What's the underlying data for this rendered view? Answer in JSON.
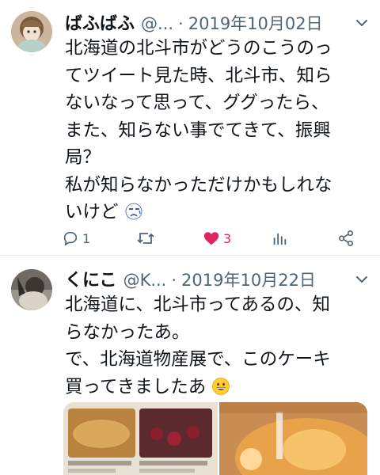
{
  "tweets": [
    {
      "display_name": "ばふばふ",
      "handle": "@...",
      "separator": "·",
      "date": "2019年10月02日",
      "text_lines": [
        "北海道の北斗市がどうのこうのっ",
        "てツイート見た時、北斗市、知ら",
        "ないなって思って、ググったら、",
        "また、知らない事でてきて、振興",
        "局？",
        "私が知らなかっただけかもしれな",
        "いけど"
      ],
      "trailing_emoji": "sad-face-emoji",
      "reply_count": "1",
      "retweet_count": "",
      "like_count": "3",
      "like_color": "#e0245e"
    },
    {
      "display_name": "くにこ",
      "handle": "@K...",
      "separator": "·",
      "date": "2019年10月22日",
      "text_lines": [
        "北海道に、北斗市ってあるの、知",
        "らなかったあ。",
        "で、北海道物産展で、このケーキ",
        "買ってきましたあ"
      ],
      "trailing_emoji": "grinning-face-emoji",
      "media": [
        "catalog-photo",
        "cake-photo"
      ]
    }
  ],
  "colors": {
    "text": "#0f1419",
    "muted": "#536471",
    "like": "#e0245e",
    "divider": "#e6ecf0"
  }
}
